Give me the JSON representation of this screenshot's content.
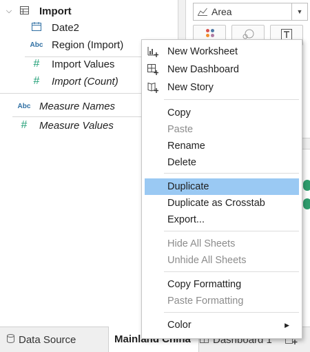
{
  "data_pane": {
    "table": {
      "name": "Import",
      "chevron_icon": "chevron-down-icon",
      "icon": "table-icon"
    },
    "fields": [
      {
        "name": "Date2",
        "type_icon": "calendar-icon",
        "italic": false
      },
      {
        "name": "Region (Import)",
        "type_icon": "abc-string-icon",
        "type_label": "Abc",
        "italic": false
      },
      {
        "name": "Import Values",
        "type_icon": "hash-measure-icon",
        "type_label": "#",
        "italic": false
      },
      {
        "name": "Import (Count)",
        "type_icon": "hash-measure-icon",
        "type_label": "#",
        "italic": true
      }
    ],
    "measure_names": {
      "name": "Measure Names",
      "type_label": "Abc"
    },
    "measure_values": {
      "name": "Measure Values",
      "type_label": "#"
    }
  },
  "marks_card": {
    "mark_type": "Area",
    "mark_type_icon": "area-chart-icon",
    "buttons": [
      {
        "icon": "color-dots-icon"
      },
      {
        "icon": "size-icon"
      },
      {
        "icon": "label-icon",
        "glyph": "T"
      }
    ]
  },
  "context_menu": {
    "items": [
      {
        "label": "New Worksheet",
        "icon": "new-worksheet-icon",
        "enabled": true
      },
      {
        "label": "New Dashboard",
        "icon": "new-dashboard-icon",
        "enabled": true
      },
      {
        "label": "New Story",
        "icon": "new-story-icon",
        "enabled": true
      },
      {
        "label": "Copy",
        "enabled": true
      },
      {
        "label": "Paste",
        "enabled": false
      },
      {
        "label": "Rename",
        "enabled": true
      },
      {
        "label": "Delete",
        "enabled": true
      },
      {
        "label": "Duplicate",
        "enabled": true,
        "highlighted": true
      },
      {
        "label": "Duplicate as Crosstab",
        "enabled": true
      },
      {
        "label": "Export...",
        "enabled": true
      },
      {
        "label": "Hide All Sheets",
        "enabled": false
      },
      {
        "label": "Unhide All Sheets",
        "enabled": false
      },
      {
        "label": "Copy Formatting",
        "enabled": true
      },
      {
        "label": "Paste Formatting",
        "enabled": false
      },
      {
        "label": "Color",
        "enabled": true,
        "submenu": true,
        "submenu_glyph": "▶"
      }
    ]
  },
  "tabs": {
    "data_source": {
      "label": "Data Source",
      "icon": "database-icon"
    },
    "sheets": [
      {
        "label": "Mainland China",
        "active": true
      },
      {
        "label": "Dashboard 1",
        "icon": "dashboard-icon",
        "active": false
      }
    ],
    "new_sheet_icon": "new-sheet-icon"
  },
  "colors": {
    "highlight": "#9ac9f3",
    "measure_green": "#27a27a",
    "dimension_blue": "#2f6fa3",
    "disabled_text": "#8c8c8c"
  }
}
